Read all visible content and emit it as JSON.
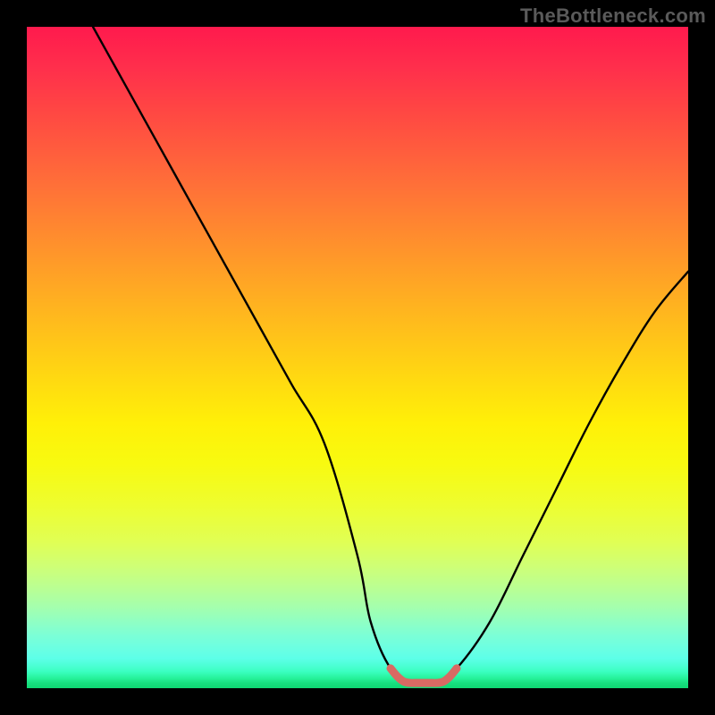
{
  "watermark": "TheBottleneck.com",
  "colors": {
    "frame_background": "#000000",
    "curve_stroke": "#000000",
    "floor_marker_stroke": "#d86a63",
    "gradient_top": "#ff1a4d",
    "gradient_bottom": "#0fd872"
  },
  "chart_data": {
    "type": "line",
    "title": "",
    "xlabel": "",
    "ylabel": "",
    "xlim": [
      0,
      100
    ],
    "ylim": [
      0,
      100
    ],
    "grid": false,
    "legend": false,
    "series": [
      {
        "name": "bottleneck-curve",
        "x": [
          10,
          15,
          20,
          25,
          30,
          35,
          40,
          45,
          50,
          52,
          55,
          58,
          60,
          62,
          65,
          70,
          75,
          80,
          85,
          90,
          95,
          100
        ],
        "y": [
          100,
          91,
          82,
          73,
          64,
          55,
          46,
          37,
          20,
          10,
          3,
          1,
          1,
          1,
          3,
          10,
          20,
          30,
          40,
          49,
          57,
          63
        ]
      },
      {
        "name": "optimal-floor",
        "x": [
          55,
          56,
          57,
          58,
          59,
          60,
          61,
          62,
          63,
          64,
          65
        ],
        "y": [
          3,
          1.8,
          1,
          0.8,
          0.8,
          0.8,
          0.8,
          0.8,
          1,
          1.8,
          3
        ]
      }
    ],
    "annotations": []
  }
}
